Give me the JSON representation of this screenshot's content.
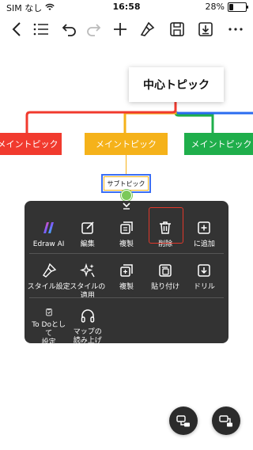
{
  "status_bar": {
    "carrier": "SIM なし",
    "time": "16:58",
    "battery": "28%"
  },
  "toolbar": {
    "icons": [
      "back-icon",
      "outline-icon",
      "undo-icon",
      "redo-icon",
      "add-icon",
      "style-brush-icon",
      "save-icon",
      "export-icon",
      "more-icon"
    ]
  },
  "mindmap": {
    "central_topic": "中心トピック",
    "main_topics": [
      {
        "label": "メイントピック",
        "color": "#f13a2e"
      },
      {
        "label": "メイントピック",
        "color": "#f5b21a"
      },
      {
        "label": "メイントピック",
        "color": "#1fae4b"
      }
    ],
    "blue_branch_color": "#2a6cf0",
    "sub_topic": "サブトピック"
  },
  "menu": {
    "rows": [
      [
        {
          "label": "Edraw AI",
          "icon": "edraw-ai-icon"
        },
        {
          "label": "編集",
          "icon": "edit-icon"
        },
        {
          "label": "複製",
          "icon": "duplicate-icon"
        },
        {
          "label": "削除",
          "icon": "delete-icon",
          "selected": true
        },
        {
          "label": "に追加",
          "icon": "add-box-icon"
        }
      ],
      [
        {
          "label": "スタイル設定",
          "icon": "style-icon"
        },
        {
          "label": "スタイルの\n適用",
          "icon": "apply-style-icon"
        },
        {
          "label": "複製",
          "icon": "copy-icon"
        },
        {
          "label": "貼り付け",
          "icon": "paste-icon"
        },
        {
          "label": "ドリル",
          "icon": "drill-icon"
        }
      ],
      [
        {
          "label": "To Doとして\n設定",
          "icon": "todo-icon"
        },
        {
          "label": "マップの\n読み上げ",
          "icon": "read-aloud-icon"
        }
      ]
    ]
  },
  "fabs": [
    "layout-left-icon",
    "layout-right-icon"
  ]
}
